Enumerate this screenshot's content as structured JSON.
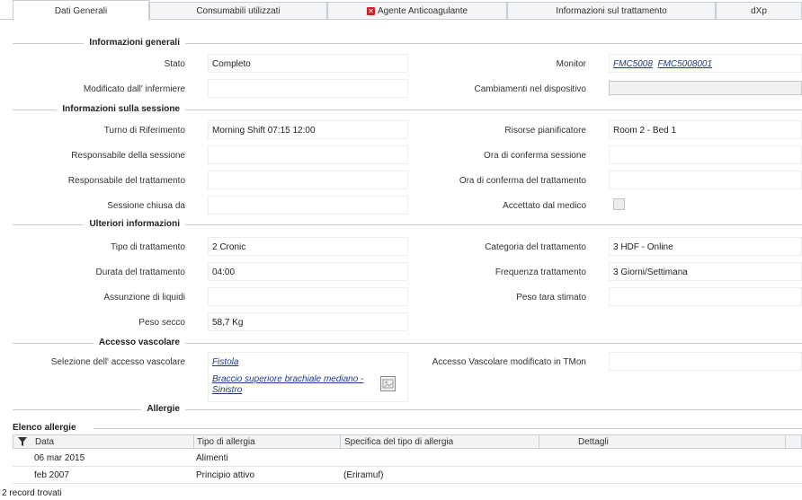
{
  "tabs": [
    {
      "label": "Dati Generali",
      "active": true
    },
    {
      "label": "Consumabili utilizzati"
    },
    {
      "label": "Agente Anticoagulante",
      "icon": "red-x-icon"
    },
    {
      "label": "Informazioni sul trattamento"
    },
    {
      "label": "dXp"
    }
  ],
  "sections": {
    "general": "Informazioni generali",
    "session": "Informazioni sulla sessione",
    "further": "Ulteriori informazioni",
    "vascular": "Accesso vascolare",
    "allergies": "Allergie"
  },
  "general": {
    "stato_label": "Stato",
    "stato_value": "Completo",
    "monitor_label": "Monitor",
    "monitor_link1": "FMC5008",
    "monitor_link2": "FMC5008001",
    "modificato_label": "Modificato dall' infermiere",
    "modificato_value": "",
    "cambiamenti_label": "Cambiamenti nel dispositivo",
    "cambiamenti_value": ""
  },
  "session": {
    "turno_label": "Turno di Riferimento",
    "turno_value": "Morning Shift  07:15  12:00",
    "risorse_label": "Risorse pianificatore",
    "risorse_value": "Room 2 - Bed 1",
    "resp_sessione_label": "Responsabile della sessione",
    "resp_sessione_value": "",
    "ora_conf_sessione_label": "Ora di conferma sessione",
    "ora_conf_sessione_value": "",
    "resp_trattamento_label": "Responsabile del trattamento",
    "resp_trattamento_value": "",
    "ora_conf_trattamento_label": "Ora di conferma del trattamento",
    "ora_conf_trattamento_value": "",
    "chiusa_label": "Sessione chiusa da",
    "chiusa_value": "",
    "accettato_label": "Accettato dal medico",
    "accettato_checked": false
  },
  "further": {
    "tipo_label": "Tipo di trattamento",
    "tipo_value": "2  Cronic",
    "categoria_label": "Categoria del trattamento",
    "categoria_value": "3  HDF - Online",
    "durata_label": "Durata del trattamento",
    "durata_value": "04:00",
    "frequenza_label": "Frequenza trattamento",
    "frequenza_value": "3  Giorni/Settimana",
    "liquidi_label": "Assunzione di liquidi",
    "liquidi_value": "",
    "tara_label": "Peso tara stimato",
    "tara_value": "",
    "secco_label": "Peso secco",
    "secco_value": "58,7  Kg"
  },
  "vascular": {
    "selezione_label": "Selezione dell' accesso vascolare",
    "fistola_link": "Fistola",
    "braccio_link_line1": "Braccio superiore brachiale mediano -",
    "braccio_link_line2": "Sinistro",
    "modificato_tmon_label": "Accesso Vascolare modificato in TMon",
    "modificato_tmon_value": ""
  },
  "allergies": {
    "list_title": "Elenco allergie",
    "columns": [
      "Data",
      "Tipo di allergia",
      "Specifica del tipo di allergia",
      "Dettagli"
    ],
    "rows": [
      {
        "data": "06 mar 2015",
        "tipo": "Alimenti",
        "specifica": "",
        "dettagli": ""
      },
      {
        "data": "feb 2007",
        "tipo": "Principio attivo",
        "specifica": "(Eriramuf)",
        "dettagli": ""
      }
    ],
    "record_count": "2 record trovati"
  },
  "colors": {
    "link": "#1f3a8a",
    "tab_icon": "#d11f2a",
    "section_line": "#c8ccd0"
  }
}
